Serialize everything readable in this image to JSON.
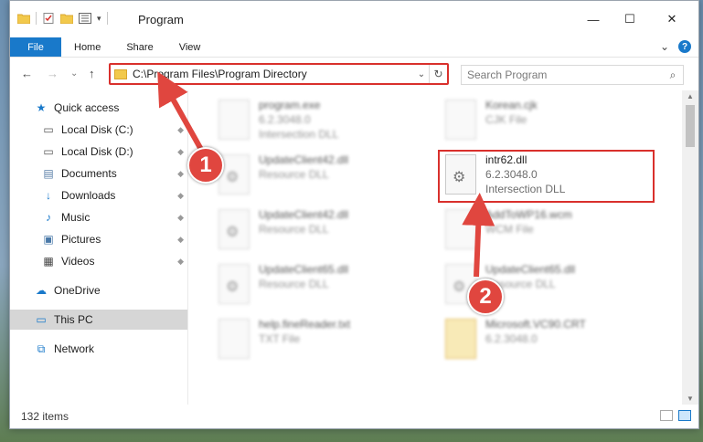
{
  "window": {
    "title": "Program",
    "minimize_glyph": "—",
    "maximize_glyph": "☐",
    "close_glyph": "✕"
  },
  "ribbon": {
    "tabs": [
      "File",
      "Home",
      "Share",
      "View"
    ],
    "expand_glyph": "⌄",
    "help_glyph": "?"
  },
  "nav": {
    "back_glyph": "←",
    "forward_glyph": "→",
    "recent_glyph": "⌄",
    "up_glyph": "↑",
    "address": "C:\\Program Files\\Program Directory",
    "address_dropdown_glyph": "⌄",
    "refresh_glyph": "↻",
    "search_placeholder": "Search Program",
    "search_icon_glyph": "⌕"
  },
  "sidebar": {
    "items": [
      {
        "label": "Quick access",
        "icon": "star-icon",
        "glyph": "★",
        "pinned": false
      },
      {
        "label": "Local Disk (C:)",
        "icon": "drive-icon",
        "glyph": "▭",
        "pinned": true
      },
      {
        "label": "Local Disk (D:)",
        "icon": "drive-icon",
        "glyph": "▭",
        "pinned": true
      },
      {
        "label": "Documents",
        "icon": "documents-icon",
        "glyph": "▤",
        "pinned": true
      },
      {
        "label": "Downloads",
        "icon": "download-icon",
        "glyph": "↓",
        "pinned": true
      },
      {
        "label": "Music",
        "icon": "music-icon",
        "glyph": "♪",
        "pinned": true
      },
      {
        "label": "Pictures",
        "icon": "pictures-icon",
        "glyph": "▣",
        "pinned": true
      },
      {
        "label": "Videos",
        "icon": "videos-icon",
        "glyph": "▦",
        "pinned": true
      },
      {
        "label": "OneDrive",
        "icon": "cloud-icon",
        "glyph": "☁",
        "pinned": false
      },
      {
        "label": "This PC",
        "icon": "computer-icon",
        "glyph": "▭",
        "pinned": false
      },
      {
        "label": "Network",
        "icon": "network-icon",
        "glyph": "⧉",
        "pinned": false
      }
    ],
    "pin_glyph": "📌"
  },
  "files": [
    {
      "name": "program.exe",
      "line2": "6.2.3048.0",
      "line3": "Intersection DLL",
      "blurred": true
    },
    {
      "name": "Korean.cjk",
      "line2": "CJK File",
      "line3": "",
      "blurred": true
    },
    {
      "name": "UpdateClient42.dll",
      "line2": "Resource DLL",
      "line3": "",
      "blurred": true
    },
    {
      "name": "intr62.dll",
      "line2": "6.2.3048.0",
      "line3": "Intersection DLL",
      "blurred": false
    },
    {
      "name": "UpdateClient42.dll",
      "line2": "Resource DLL",
      "line3": "",
      "blurred": true
    },
    {
      "name": "AddToWP16.wcm",
      "line2": "WCM File",
      "line3": "",
      "blurred": true
    },
    {
      "name": "UpdateClient65.dll",
      "line2": "Resource DLL",
      "line3": "",
      "blurred": true
    },
    {
      "name": "UpdateClient65.dll",
      "line2": "Resource DLL",
      "line3": "",
      "blurred": true
    },
    {
      "name": "help.fineReader.txt",
      "line2": "TXT File",
      "line3": "",
      "blurred": true
    },
    {
      "name": "Microsoft.VC90.CRT",
      "line2": "6.2.3048.0",
      "line3": "",
      "blurred": true
    }
  ],
  "status": {
    "item_count": "132 items"
  },
  "annotations": {
    "step1": "1",
    "step2": "2"
  },
  "colors": {
    "accent": "#1979ca",
    "highlight": "#d9302c",
    "badge": "#e0463f"
  }
}
